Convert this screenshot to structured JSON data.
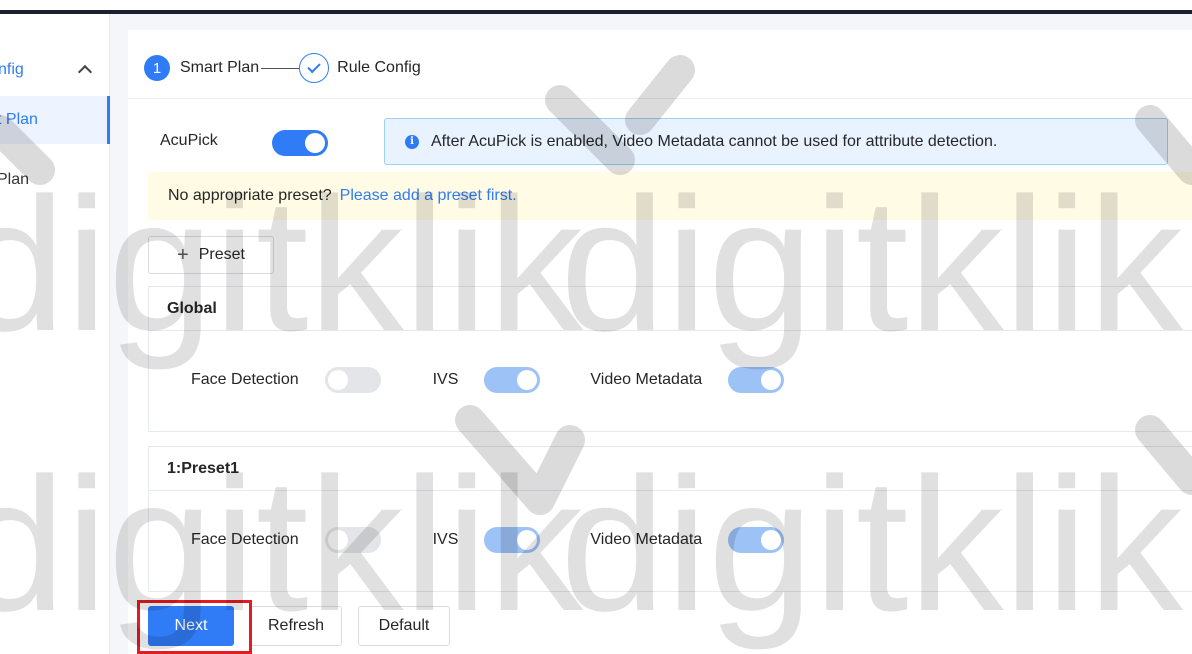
{
  "sidebar": {
    "group_label": "nfig",
    "items": [
      {
        "label": "t Plan",
        "active": true
      },
      {
        "label": "Plan",
        "active": false
      }
    ]
  },
  "steps": {
    "step1_number": "1",
    "step1_label": "Smart Plan",
    "step2_label": "Rule Config"
  },
  "acupick": {
    "label": "AcuPick",
    "enabled": true
  },
  "info_banner": {
    "text": "After AcuPick is enabled, Video Metadata cannot be used for attribute detection."
  },
  "warning_banner": {
    "text": "No appropriate preset?",
    "link": "Please add a preset first."
  },
  "preset_button": {
    "icon": "+",
    "label": "Preset"
  },
  "panels": [
    {
      "title": "Global",
      "switches": [
        {
          "label": "Face Detection",
          "state": "off"
        },
        {
          "label": "IVS",
          "state": "on"
        },
        {
          "label": "Video Metadata",
          "state": "on"
        }
      ]
    },
    {
      "title": "1:Preset1",
      "switches": [
        {
          "label": "Face Detection",
          "state": "off"
        },
        {
          "label": "IVS",
          "state": "on"
        },
        {
          "label": "Video Metadata",
          "state": "on"
        }
      ]
    }
  ],
  "buttons": {
    "next": "Next",
    "refresh": "Refresh",
    "default": "Default"
  },
  "watermark_text": "digitklik",
  "colors": {
    "accent": "#2f7cf6",
    "info_bg": "#e8f3ff",
    "warn_bg": "#fffbe5",
    "highlight": "#e31b23"
  }
}
